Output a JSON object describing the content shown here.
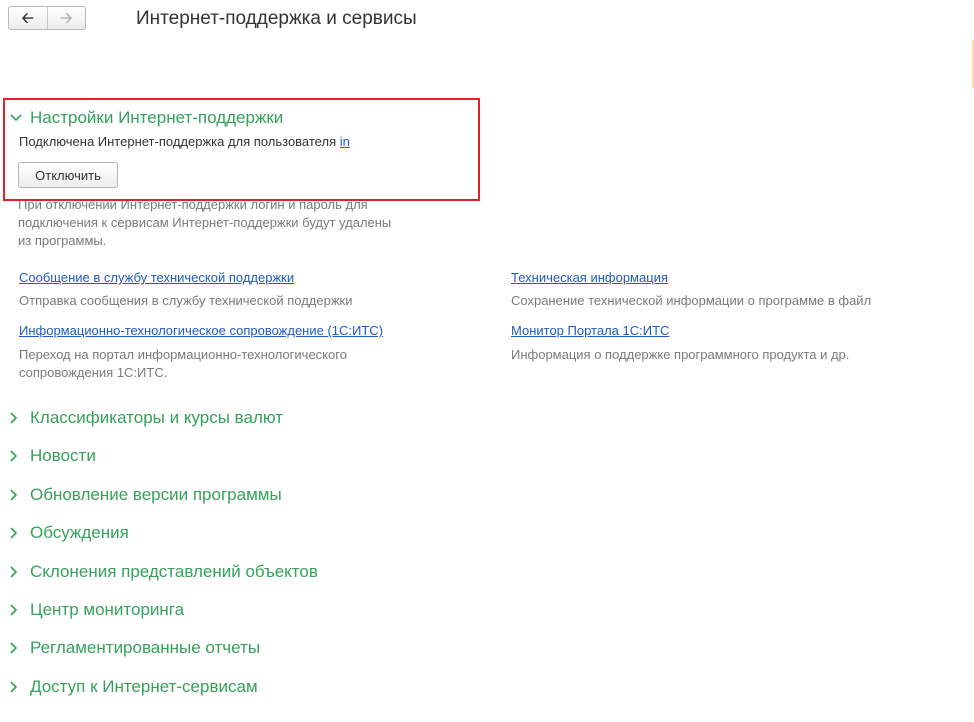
{
  "header": {
    "title": "Интернет-поддержка и сервисы",
    "back_icon": "arrow-left-icon",
    "forward_icon": "arrow-right-icon"
  },
  "colors": {
    "group_header": "#35a15b",
    "link": "#1f5bc4",
    "highlight_border": "#e0202a"
  },
  "settings": {
    "title": "Настройки Интернет-поддержки",
    "expanded": true,
    "status_text": "Подключена Интернет-поддержка для пользователя",
    "login_link": "in",
    "disconnect_label": "Отключить",
    "note": "При отключении Интернет-поддержки логин и пароль для подключения к сервисам Интернет-поддержки будут удалены из программы."
  },
  "links": [
    {
      "label": "Сообщение в службу технической поддержки",
      "description": "Отправка сообщения в службу технической поддержки"
    },
    {
      "label": "Техническая информация",
      "description": "Сохранение технической информации о программе в файл"
    },
    {
      "label": "Информационно-технологическое сопровождение (1С:ИТС)",
      "description": "Переход на портал информационно-технологического сопровождения 1С:ИТС."
    },
    {
      "label": "Монитор Портала 1С:ИТС",
      "description": "Информация о поддержке программного продукта и др."
    }
  ],
  "groups": [
    {
      "label": "Классификаторы и курсы валют"
    },
    {
      "label": "Новости"
    },
    {
      "label": "Обновление версии программы"
    },
    {
      "label": "Обсуждения"
    },
    {
      "label": "Склонения представлений объектов"
    },
    {
      "label": "Центр мониторинга"
    },
    {
      "label": "Регламентированные отчеты"
    },
    {
      "label": "Доступ к Интернет-сервисам"
    }
  ]
}
